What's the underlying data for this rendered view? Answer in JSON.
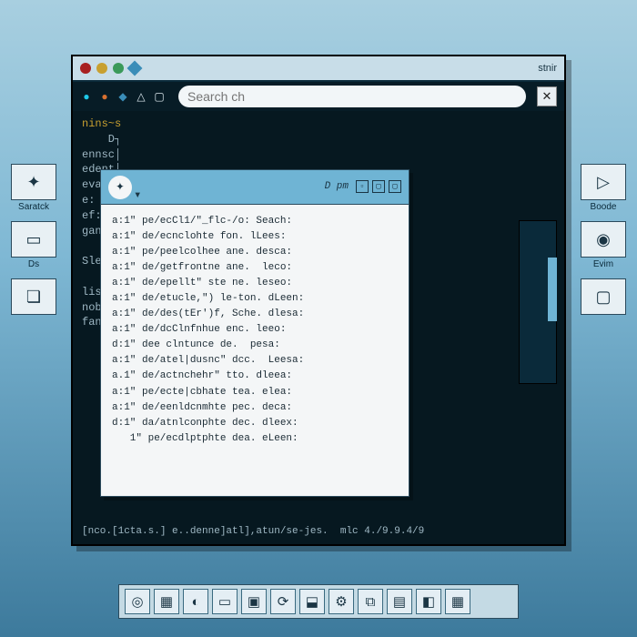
{
  "window": {
    "title": "stnir",
    "search_placeholder": "Search ch",
    "close_label": "✕",
    "term": {
      "prompt": "nins~s",
      "lines": [
        "    D┐",
        "ennsc│",
        "edent│",
        "evarc│",
        "e:   │",
        "ef:  │",
        "ganen│",
        "     │",
        "Sle/c│",
        "     │",
        "listL│",
        "nobse│",
        "fant:"
      ],
      "bottom": "[nco.[1cta.s.] e..denne]atl],atun/se-jes.  mlc 4./9.9.4/9"
    }
  },
  "popup": {
    "controls_label": "D pm",
    "lines": [
      "a:1\" pe/ecCl1/\"_flc-/o: Seach:",
      "a:1\" de/ecnclohte fon. lLees:",
      "a:1\" pe/peelcolhee ane. desca:",
      "a:1\" de/getfrontne ane.  leco:",
      "a:1\" de/epellt\" ste ne. leseo:",
      "a:1\" de/etucle,\") le-ton. dLeen:",
      "a:1\" de/des(tEr')f, Sche. dlesa:",
      "a:1\" de/dcClnfnhue enc. leeo:",
      "d:1\" dee clntunce de.  pesa:",
      "a:1\" de/atel|dusnc\" dcc.  Leesa:",
      "a.1\" de/actnchehr\" tto. dleea:",
      "a:1\" pe/ecte|cbhate tea. elea:",
      "a:1\" de/eenldcnmhte pec. deca:",
      "d:1\" da/atnlconphte dec. dleex:",
      "   1\" pe/ecdlptphte dea. eLeen:"
    ]
  },
  "desktop": {
    "left": [
      {
        "icon": "✦",
        "label": "Saratck"
      },
      {
        "icon": "▭",
        "label": "Ds"
      },
      {
        "icon": "❏",
        "label": ""
      }
    ],
    "right": [
      {
        "icon": "▷",
        "label": "Boode"
      },
      {
        "icon": "◉",
        "label": "Evim"
      },
      {
        "icon": "▢",
        "label": ""
      }
    ]
  },
  "taskbar": {
    "items": [
      "◎",
      "▦",
      "◐",
      "▭",
      "▣",
      "⟳",
      "⬓",
      "⚙",
      "⧉",
      "▤",
      "◧",
      "▦"
    ]
  }
}
